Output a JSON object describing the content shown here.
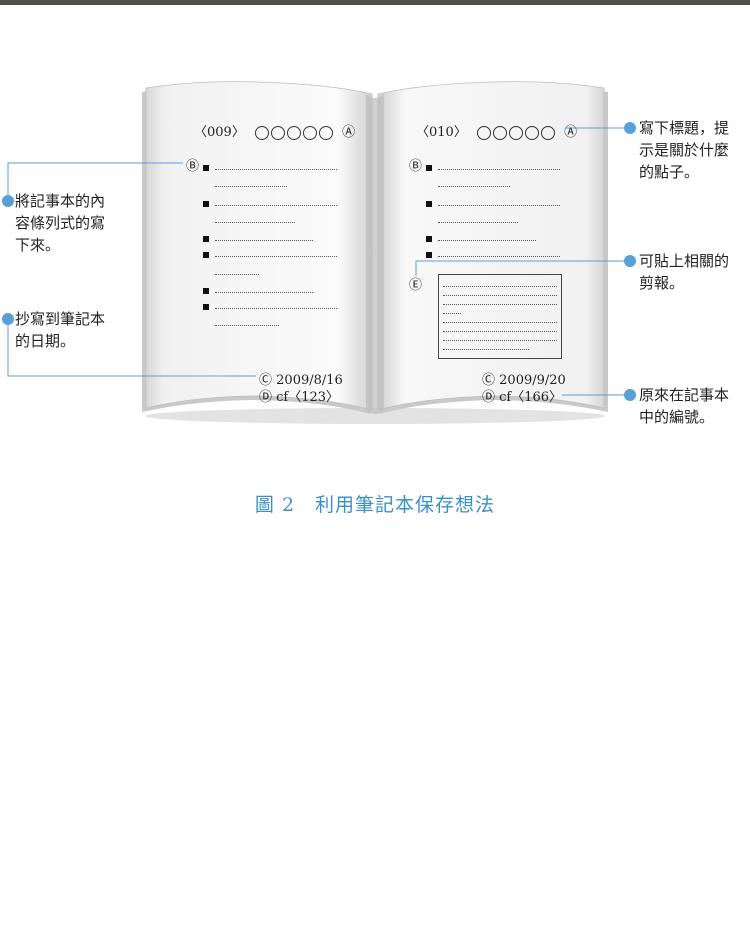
{
  "left_page": {
    "header": "〈009〉",
    "marker_a": "Ⓐ",
    "marker_b": "Ⓑ",
    "marker_c": "Ⓒ",
    "marker_d": "Ⓓ",
    "date": "2009/8/16",
    "cf": "cf〈123〉"
  },
  "right_page": {
    "header": "〈010〉",
    "marker_a": "Ⓐ",
    "marker_b": "Ⓑ",
    "marker_c": "Ⓒ",
    "marker_d": "Ⓓ",
    "marker_e": "Ⓔ",
    "date": "2009/9/20",
    "cf": "cf〈166〉"
  },
  "callouts": {
    "list_items": "將記事本的內\n容條列式的寫\n下來。",
    "copy_date": "抄寫到筆記本\n的日期。",
    "title_hint": "寫下標題，提\n示是關於什麼\n的點子。",
    "clippings": "可貼上相關的\n剪報。",
    "original_number": "原來在記事本\n中的編號。"
  },
  "caption": "圖 2　利用筆記本保存想法",
  "colors": {
    "accent": "#5b9fd8",
    "caption": "#3b8fc9",
    "topbar": "#4f4f4b"
  }
}
